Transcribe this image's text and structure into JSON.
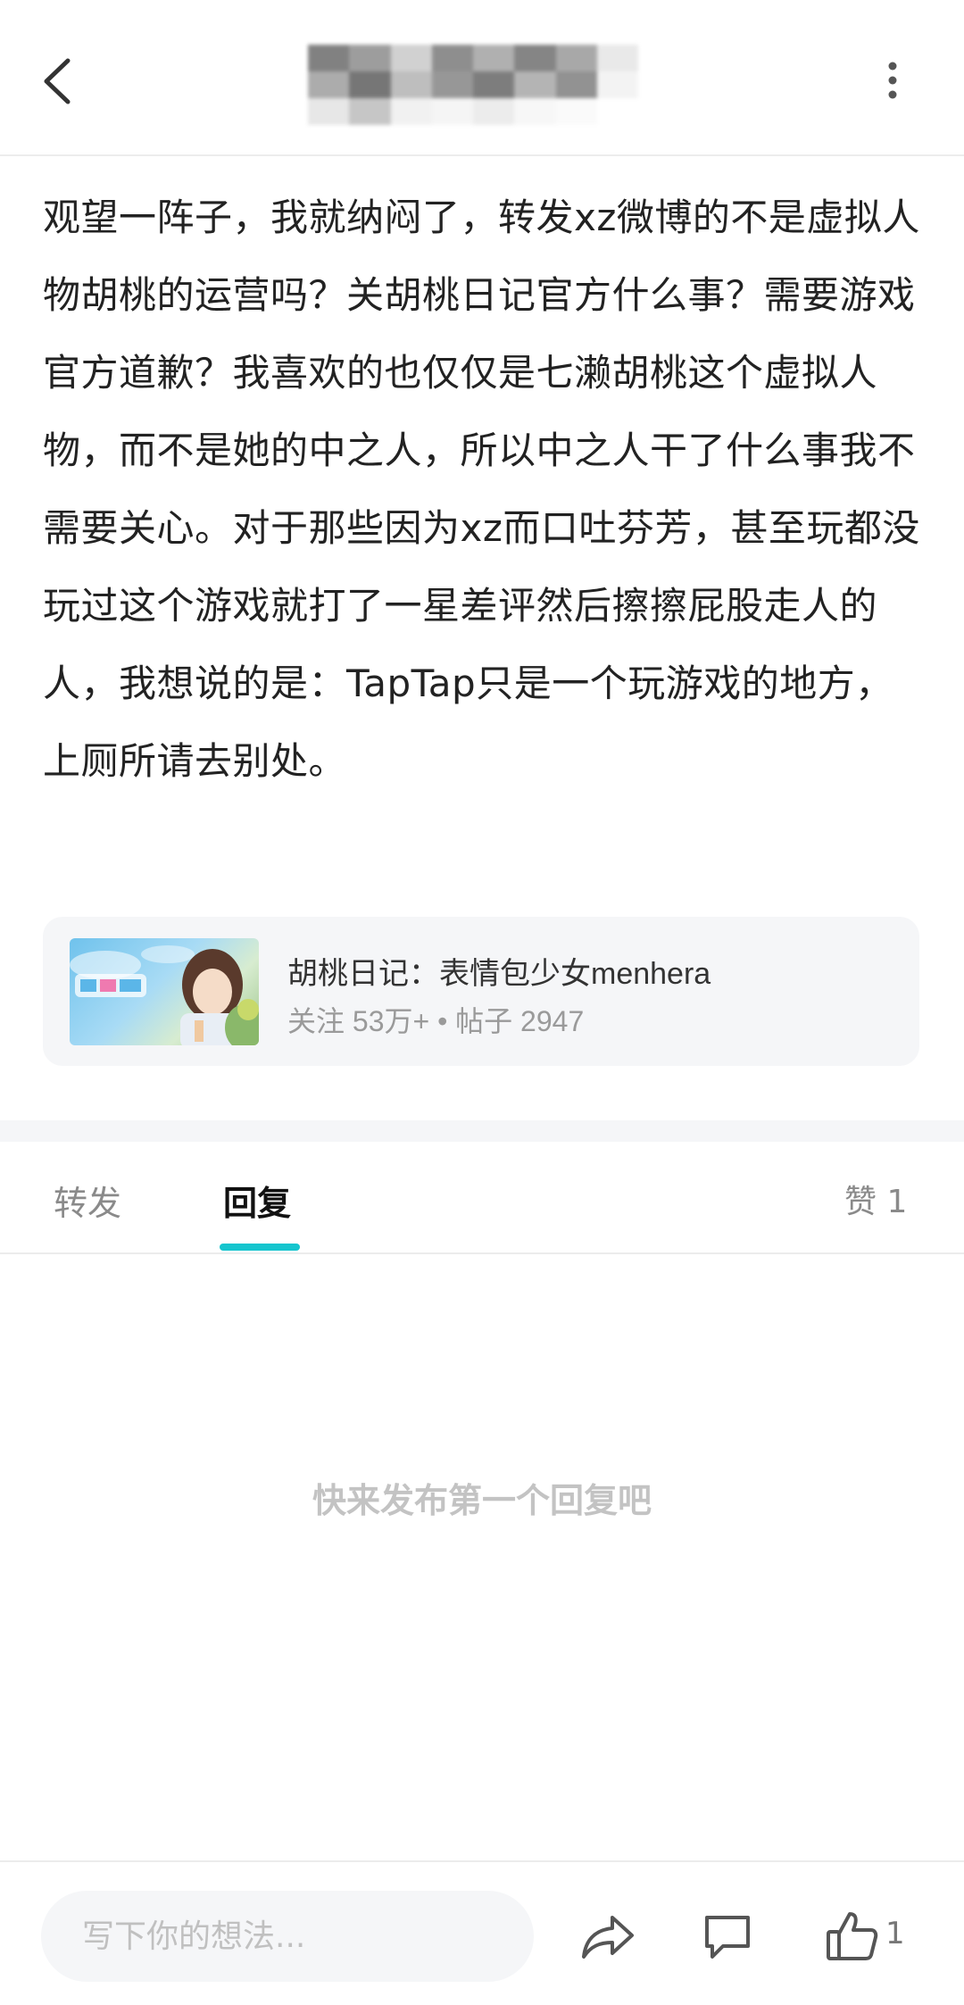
{
  "header": {
    "title_blurred": true,
    "back_icon": "chevron-left-icon",
    "more_icon": "more-vertical-icon"
  },
  "post": {
    "text": "观望一阵子，我就纳闷了，转发xz微博的不是虚拟人物胡桃的运营吗？关胡桃日记官方什么事？需要游戏官方道歉？我喜欢的也仅仅是七濑胡桃这个虚拟人物，而不是她的中之人，所以中之人干了什么事我不需要关心。对于那些因为xz而口吐芬芳，甚至玩都没玩过这个游戏就打了一星差评然后擦擦屁股走人的人，我想说的是：TapTap只是一个玩游戏的地方，上厕所请去别处。"
  },
  "game_card": {
    "title": "胡桃日记：表情包少女menhera",
    "stats": "关注 53万+ • 帖子 2947"
  },
  "tabs": {
    "forward": "转发",
    "reply": "回复",
    "like": "赞 1",
    "active": "reply"
  },
  "replies": {
    "empty_hint": "快来发布第一个回复吧"
  },
  "bottom_bar": {
    "input_placeholder": "写下你的想法...",
    "like_count": "1",
    "icons": [
      "share-icon",
      "comment-icon",
      "thumbs-up-icon"
    ]
  },
  "colors": {
    "accent": "#15c5ce",
    "muted_text": "#9a9a9a",
    "card_bg": "#f5f6f8"
  }
}
